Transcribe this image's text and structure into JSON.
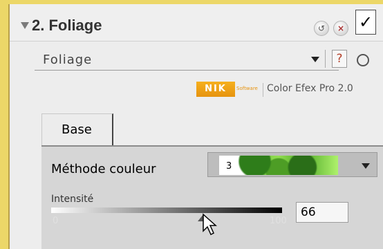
{
  "filter_panel": {
    "title": "2. Foliage",
    "reset_icon": "reset-icon",
    "close_icon": "close-icon",
    "enabled_check": "✓"
  },
  "preset": {
    "value": "Foliage",
    "help_label": "?",
    "target_icon": "target-icon"
  },
  "brand": {
    "logo": "NIK",
    "software": "Software",
    "product": "Color Efex Pro 2.0",
    "accent_color": "#e6930f"
  },
  "tabs": [
    {
      "label": "Base",
      "selected": true
    }
  ],
  "controls": {
    "method": {
      "label": "Méthode couleur",
      "value": "3"
    },
    "intensity": {
      "label": "Intensité",
      "min_label": "0",
      "max_label": "100",
      "value": "66",
      "level": 0.66
    }
  }
}
